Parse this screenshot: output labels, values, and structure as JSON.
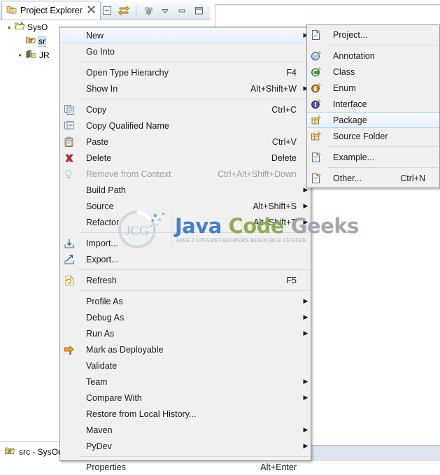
{
  "view": {
    "tab_title": "Project Explorer",
    "tab_close_glyph": "✄",
    "icons": {
      "view_icon": "project-explorer-icon",
      "collapse_all": "collapse-all-icon",
      "link_with_editor": "link-with-editor-icon",
      "focus_on_active": "focus-on-active-task-icon",
      "view_menu": "view-menu-chevron-icon",
      "minimize": "minimize-icon",
      "maximize": "maximize-icon"
    }
  },
  "tree": {
    "rows": [
      {
        "label": "SysO",
        "indent": 6,
        "twisty": "▴",
        "icon": "java-project-icon",
        "selected": false
      },
      {
        "label": "sr",
        "indent": 22,
        "twisty": "",
        "icon": "source-folder-icon",
        "selected": true
      },
      {
        "label": "JR",
        "indent": 22,
        "twisty": "▸",
        "icon": "jre-library-icon",
        "selected": false
      }
    ]
  },
  "status_bar": {
    "icon": "source-folder-icon",
    "text": "src - SysOu"
  },
  "context_menu": {
    "items": [
      {
        "label": "New",
        "accel": "",
        "arrow": true,
        "icon": "",
        "highlight": true,
        "disabled": false
      },
      {
        "label": "Go Into",
        "accel": "",
        "arrow": false,
        "icon": "",
        "highlight": false,
        "disabled": false
      },
      {
        "sep": true
      },
      {
        "label": "Open Type Hierarchy",
        "accel": "F4",
        "arrow": false,
        "icon": "",
        "highlight": false,
        "disabled": false
      },
      {
        "label": "Show In",
        "accel": "Alt+Shift+W",
        "arrow": true,
        "icon": "",
        "highlight": false,
        "disabled": false
      },
      {
        "sep": true
      },
      {
        "label": "Copy",
        "accel": "Ctrl+C",
        "arrow": false,
        "icon": "copy-icon",
        "highlight": false,
        "disabled": false
      },
      {
        "label": "Copy Qualified Name",
        "accel": "",
        "arrow": false,
        "icon": "copy-qualified-name-icon",
        "highlight": false,
        "disabled": false
      },
      {
        "label": "Paste",
        "accel": "Ctrl+V",
        "arrow": false,
        "icon": "paste-icon",
        "highlight": false,
        "disabled": false
      },
      {
        "label": "Delete",
        "accel": "Delete",
        "arrow": false,
        "icon": "delete-icon",
        "highlight": false,
        "disabled": false
      },
      {
        "label": "Remove from Context",
        "accel": "Ctrl+Alt+Shift+Down",
        "arrow": false,
        "icon": "remove-from-context-icon",
        "highlight": false,
        "disabled": true
      },
      {
        "label": "Build Path",
        "accel": "",
        "arrow": true,
        "icon": "",
        "highlight": false,
        "disabled": false
      },
      {
        "label": "Source",
        "accel": "Alt+Shift+S",
        "arrow": true,
        "icon": "",
        "highlight": false,
        "disabled": false
      },
      {
        "label": "Refactor",
        "accel": "Alt+Shift+T",
        "arrow": true,
        "icon": "",
        "highlight": false,
        "disabled": false
      },
      {
        "sep": true
      },
      {
        "label": "Import...",
        "accel": "",
        "arrow": false,
        "icon": "import-icon",
        "highlight": false,
        "disabled": false
      },
      {
        "label": "Export...",
        "accel": "",
        "arrow": false,
        "icon": "export-icon",
        "highlight": false,
        "disabled": false
      },
      {
        "sep": true
      },
      {
        "label": "Refresh",
        "accel": "F5",
        "arrow": false,
        "icon": "refresh-icon",
        "highlight": false,
        "disabled": false
      },
      {
        "sep": true
      },
      {
        "label": "Profile As",
        "accel": "",
        "arrow": true,
        "icon": "",
        "highlight": false,
        "disabled": false
      },
      {
        "label": "Debug As",
        "accel": "",
        "arrow": true,
        "icon": "",
        "highlight": false,
        "disabled": false
      },
      {
        "label": "Run As",
        "accel": "",
        "arrow": true,
        "icon": "",
        "highlight": false,
        "disabled": false
      },
      {
        "label": "Mark as Deployable",
        "accel": "",
        "arrow": false,
        "icon": "mark-as-deployable-icon",
        "highlight": false,
        "disabled": false
      },
      {
        "label": "Validate",
        "accel": "",
        "arrow": false,
        "icon": "",
        "highlight": false,
        "disabled": false
      },
      {
        "label": "Team",
        "accel": "",
        "arrow": true,
        "icon": "",
        "highlight": false,
        "disabled": false
      },
      {
        "label": "Compare With",
        "accel": "",
        "arrow": true,
        "icon": "",
        "highlight": false,
        "disabled": false
      },
      {
        "label": "Restore from Local History...",
        "accel": "",
        "arrow": false,
        "icon": "",
        "highlight": false,
        "disabled": false
      },
      {
        "label": "Maven",
        "accel": "",
        "arrow": true,
        "icon": "",
        "highlight": false,
        "disabled": false
      },
      {
        "label": "PyDev",
        "accel": "",
        "arrow": true,
        "icon": "",
        "highlight": false,
        "disabled": false
      },
      {
        "sep": true
      },
      {
        "label": "Properties",
        "accel": "Alt+Enter",
        "arrow": false,
        "icon": "",
        "highlight": false,
        "disabled": false
      }
    ]
  },
  "new_submenu": {
    "items": [
      {
        "label": "Project...",
        "accel": "",
        "icon": "new-project-icon",
        "highlight": false
      },
      {
        "sep": true
      },
      {
        "label": "Annotation",
        "accel": "",
        "icon": "new-annotation-icon",
        "highlight": false
      },
      {
        "label": "Class",
        "accel": "",
        "icon": "new-class-icon",
        "highlight": false
      },
      {
        "label": "Enum",
        "accel": "",
        "icon": "new-enum-icon",
        "highlight": false
      },
      {
        "label": "Interface",
        "accel": "",
        "icon": "new-interface-icon",
        "highlight": false
      },
      {
        "label": "Package",
        "accel": "",
        "icon": "new-package-icon",
        "highlight": true
      },
      {
        "label": "Source Folder",
        "accel": "",
        "icon": "new-source-folder-icon",
        "highlight": false
      },
      {
        "sep": true
      },
      {
        "label": "Example...",
        "accel": "",
        "icon": "new-example-icon",
        "highlight": false
      },
      {
        "sep": true
      },
      {
        "label": "Other...",
        "accel": "Ctrl+N",
        "icon": "new-other-icon",
        "highlight": false
      }
    ]
  },
  "watermark": {
    "word1": "Java",
    "word2": "Code",
    "word3": "Geeks",
    "subtitle": "JAVA 2 JAVA DEVELOPERS RESOURCE CENTER",
    "logo_text": "JCG"
  },
  "colors": {
    "menu_bg": "#f0f0f0",
    "highlight_bg": "#e6f1fb",
    "highlight_border": "#b8d6ef",
    "selection_blue": "#cfe2f6",
    "tab_gradient_end": "#dce5f0",
    "accent_blue": "#3b7cc4",
    "accent_green": "#8aab4a"
  }
}
